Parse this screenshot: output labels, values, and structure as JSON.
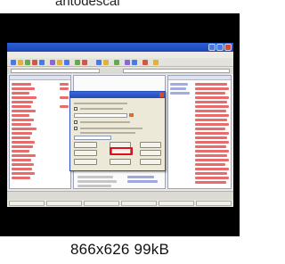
{
  "caption_cropped": "antodescal",
  "thumbnail": {
    "frame_color": "#000000",
    "screenshot": {
      "title_bar_color": "#1d45b3",
      "dialog_highlight_color": "#e3101b",
      "icons": [
        "close-icon",
        "checkbox-icon",
        "folder-icon"
      ]
    }
  },
  "meta": {
    "label": "866x626 99kB"
  }
}
